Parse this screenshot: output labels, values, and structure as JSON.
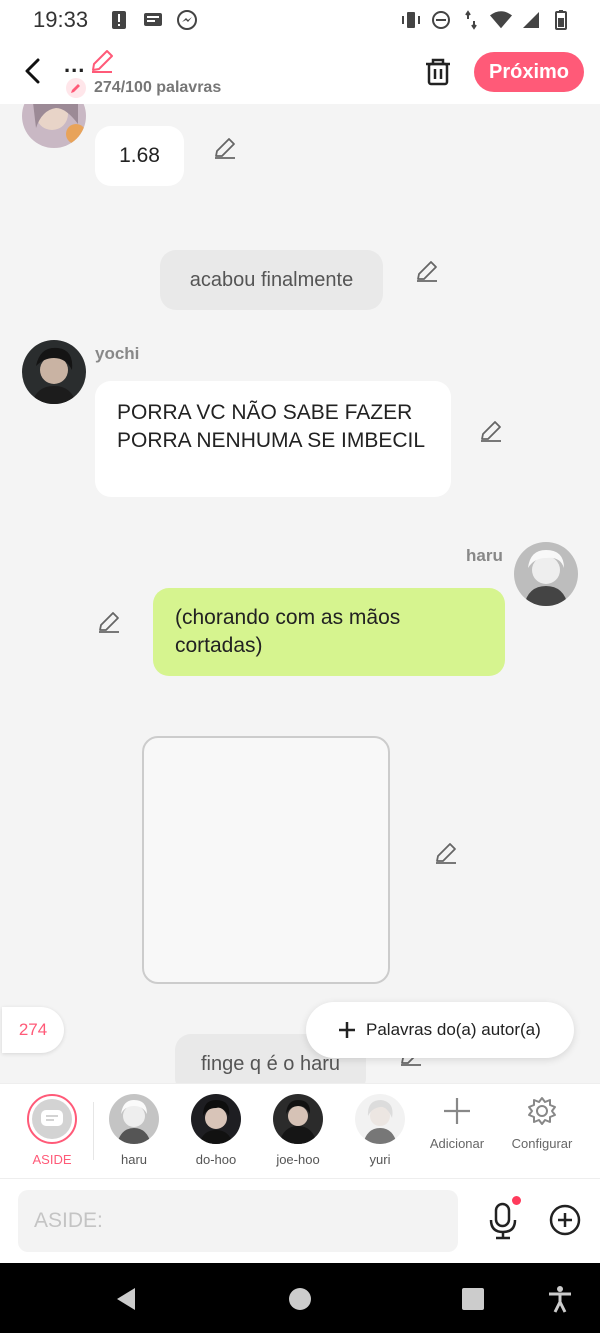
{
  "status_bar": {
    "time": "19:33",
    "icons_left": [
      "alert-icon",
      "cast-icon",
      "messenger-icon"
    ],
    "icons_right": [
      "vibrate-icon",
      "dnd-icon",
      "data-icon",
      "wifi-icon",
      "signal-icon",
      "battery-icon"
    ]
  },
  "header": {
    "title": "...",
    "word_count": "274/100 palavras",
    "next_label": "Próximo"
  },
  "messages": [
    {
      "type": "left",
      "sender": "",
      "text": "1.68"
    },
    {
      "type": "narration",
      "text": "acabou finalmente"
    },
    {
      "type": "left",
      "sender": "yochi",
      "text": "PORRA VC NÃO SABE FAZER PORRA NENHUMA SE IMBECIL"
    },
    {
      "type": "right",
      "sender": "haru",
      "text": "(chorando com as mãos cortadas)"
    },
    {
      "type": "image",
      "text": ""
    },
    {
      "type": "narration",
      "text": "finge q é o haru"
    }
  ],
  "floating": {
    "count": "274",
    "author_words": "Palavras do(a) autor(a)"
  },
  "characters": [
    {
      "name": "ASIDE",
      "active": true
    },
    {
      "name": "haru"
    },
    {
      "name": "do-hoo"
    },
    {
      "name": "joe-hoo"
    },
    {
      "name": "yuri"
    }
  ],
  "tools": {
    "add": "Adicionar",
    "settings": "Configurar"
  },
  "input": {
    "placeholder": "ASIDE:"
  },
  "colors": {
    "accent": "#ff5a78",
    "bubble_green": "#d6f48f"
  }
}
